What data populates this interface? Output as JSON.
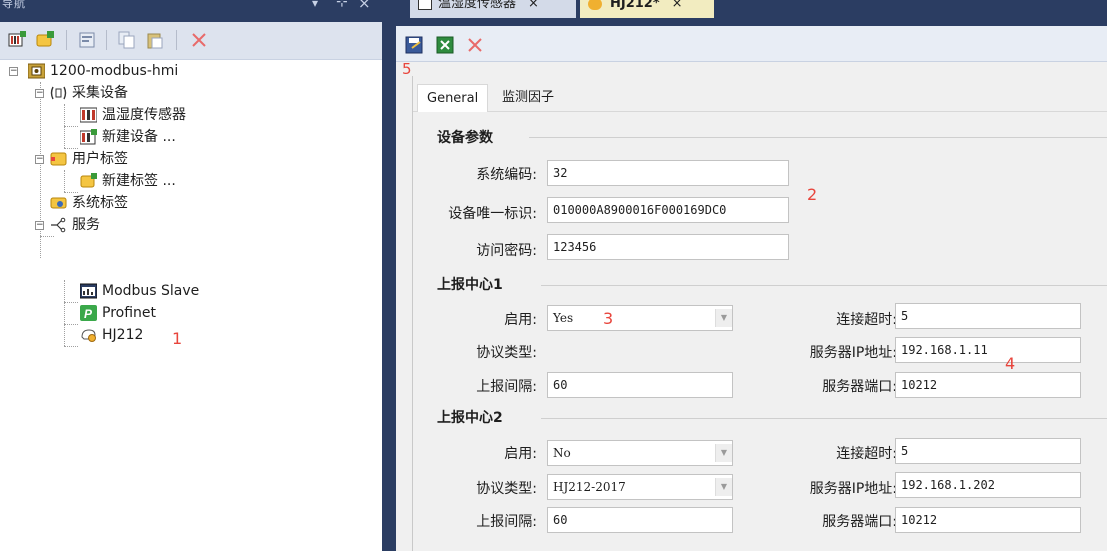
{
  "nav": {
    "title": "导航",
    "tree": {
      "project": "1200-modbus-hmi",
      "acquisition": "采集设备",
      "device1": "温湿度传感器",
      "new_device": "新建设备 ...",
      "user_tags": "用户标签",
      "new_tag": "新建标签 ...",
      "system_tags": "系统标签",
      "services": "服务",
      "modbus": "Modbus Slave",
      "profinet": "Profinet",
      "hj212": "HJ212"
    },
    "annotation_1": "1"
  },
  "doc": {
    "tabs": [
      {
        "label": "温湿度传感器"
      },
      {
        "label": "HJ212*"
      }
    ],
    "annotation_5": "5",
    "form_tabs": [
      "General",
      "监测因子"
    ],
    "device_params": {
      "title": "设备参数",
      "system_code_label": "系统编码:",
      "system_code": "32",
      "unique_id_label": "设备唯一标识:",
      "unique_id": "010000A8900016F000169DC0",
      "password_label": "访问密码:",
      "password": "123456",
      "annotation_2": "2"
    },
    "center1": {
      "title": "上报中心1",
      "enable_label": "启用:",
      "enable": "Yes",
      "protocol_label": "协议类型:",
      "interval_label": "上报间隔:",
      "interval": "60",
      "timeout_label": "连接超时:",
      "timeout": "5",
      "ip_label": "服务器IP地址:",
      "ip": "192.168.1.11",
      "port_label": "服务器端口:",
      "port": "10212",
      "annotation_3": "3",
      "annotation_4": "4"
    },
    "center2": {
      "title": "上报中心2",
      "enable_label": "启用:",
      "enable": "No",
      "protocol_label": "协议类型:",
      "protocol": "HJ212-2017",
      "interval_label": "上报间隔:",
      "interval": "60",
      "timeout_label": "连接超时:",
      "timeout": "5",
      "ip_label": "服务器IP地址:",
      "ip": "192.168.1.202",
      "port_label": "服务器端口:",
      "port": "10212"
    }
  },
  "colors": {
    "title_bar": "#2b3d62",
    "active_tab": "#f2ecc0",
    "annotation": "#e8453c"
  }
}
